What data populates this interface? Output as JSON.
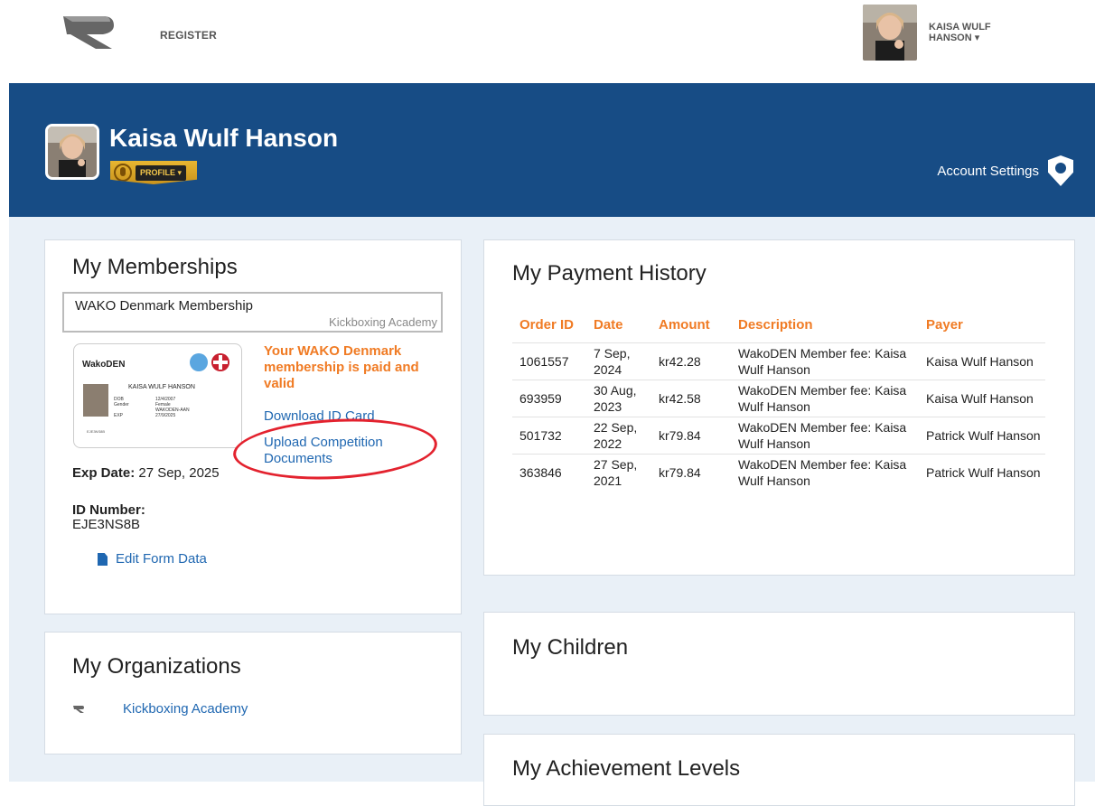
{
  "topbar": {
    "register_label": "REGISTER",
    "user_name": "KAISA WULF HANSON ▾"
  },
  "banner": {
    "name": "Kaisa Wulf Hanson",
    "profile_label": "PROFILE ▾",
    "account_settings": "Account Settings"
  },
  "memberships": {
    "title": "My Memberships",
    "membership_name": "WAKO Denmark Membership",
    "organization": "Kickboxing Academy",
    "card": {
      "brand": "WakoDEN",
      "holder": "KAISA WULF HANSON",
      "labels": "DOB\nGender\n\nEXP",
      "values": "12/4/2007\nFemale\nWAKODEN-AAN\n27/9/2025",
      "number": "EJE3NS8B"
    },
    "status": "Your WAKO Denmark membership is paid and valid",
    "download_link": "Download ID Card",
    "upload_link": "Upload Competition Documents",
    "exp_label": "Exp Date:",
    "exp_value": "27 Sep, 2025",
    "id_label": "ID Number:",
    "id_value": "EJE3NS8B",
    "edit_link": "Edit Form Data"
  },
  "organizations": {
    "title": "My Organizations",
    "items": [
      {
        "name": "Kickboxing Academy"
      }
    ]
  },
  "payments": {
    "title": "My Payment History",
    "headers": [
      "Order ID",
      "Date",
      "Amount",
      "Description",
      "Payer"
    ],
    "rows": [
      {
        "order_id": "1061557",
        "date": "7 Sep, 2024",
        "amount": "kr42.28",
        "description": "WakoDEN Member fee: Kaisa Wulf Hanson",
        "payer": "Kaisa Wulf Hanson"
      },
      {
        "order_id": "693959",
        "date": "30 Aug, 2023",
        "amount": "kr42.58",
        "description": "WakoDEN Member fee: Kaisa Wulf Hanson",
        "payer": "Kaisa Wulf Hanson"
      },
      {
        "order_id": "501732",
        "date": "22 Sep, 2022",
        "amount": "kr79.84",
        "description": "WakoDEN Member fee: Kaisa Wulf Hanson",
        "payer": "Patrick Wulf Hanson"
      },
      {
        "order_id": "363846",
        "date": "27 Sep, 2021",
        "amount": "kr79.84",
        "description": "WakoDEN Member fee: Kaisa Wulf Hanson",
        "payer": "Patrick Wulf Hanson"
      }
    ]
  },
  "children": {
    "title": "My Children"
  },
  "achievements": {
    "title": "My Achievement Levels"
  },
  "colors": {
    "banner": "#174c85",
    "accent_orange": "#f07b24",
    "link_blue": "#1f67b1",
    "annotation_red": "#e3222e"
  },
  "icons": [
    "site-logo-icon",
    "shield-user-icon",
    "profile-badge-icon",
    "document-icon",
    "org-logo-icon"
  ]
}
